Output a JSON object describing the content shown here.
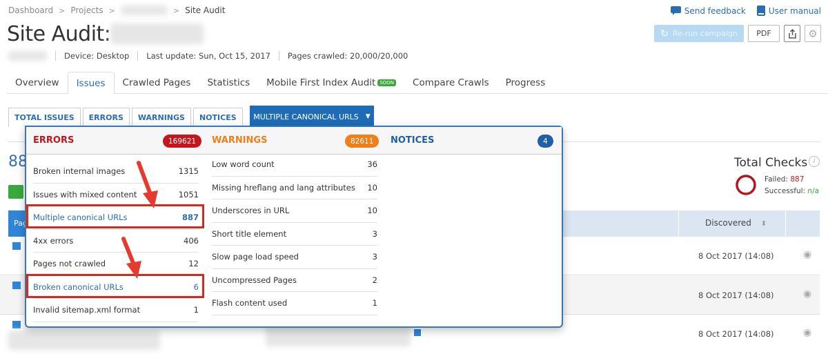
{
  "breadcrumb": [
    "Dashboard",
    "Projects",
    "Site Audit"
  ],
  "page_title": "Site Audit:",
  "meta": {
    "device": "Device: Desktop",
    "last_update": "Last update: Sun, Oct 15, 2017",
    "pages_crawled": "Pages crawled: 20,000/20,000"
  },
  "top_links": {
    "feedback": "Send feedback",
    "manual": "User manual"
  },
  "toolbar": {
    "rerun": "Re-run campaign",
    "pdf": "PDF"
  },
  "tabs": [
    {
      "label": "Overview"
    },
    {
      "label": "Issues",
      "active": true
    },
    {
      "label": "Crawled Pages"
    },
    {
      "label": "Statistics"
    },
    {
      "label": "Mobile First Index Audit",
      "badge": "SOON"
    },
    {
      "label": "Compare Crawls"
    },
    {
      "label": "Progress"
    }
  ],
  "subtabs": [
    "TOTAL ISSUES",
    "ERRORS",
    "WARNINGS",
    "NOTICES"
  ],
  "issue_dropdown": {
    "selected": "MULTIPLE CANONICAL URLS"
  },
  "dropdown": {
    "errors": {
      "title": "ERRORS",
      "count": "169621",
      "color": "#c4161c",
      "items": [
        {
          "label": "Broken internal images",
          "count": "1315"
        },
        {
          "label": "Issues with mixed content",
          "count": "1051"
        },
        {
          "label": "Multiple canonical URLs",
          "count": "887",
          "highlighted": true
        },
        {
          "label": "4xx errors",
          "count": "406"
        },
        {
          "label": "Pages not crawled",
          "count": "12"
        },
        {
          "label": "Broken canonical URLs",
          "count": "6",
          "highlighted": true
        },
        {
          "label": "Invalid sitemap.xml format",
          "count": "1"
        }
      ]
    },
    "warnings": {
      "title": "WARNINGS",
      "count": "82611",
      "color": "#f07f1a",
      "items": [
        {
          "label": "Low word count",
          "count": "36"
        },
        {
          "label": "Missing hreflang and lang attributes",
          "count": "10"
        },
        {
          "label": "Underscores in URL",
          "count": "10"
        },
        {
          "label": "Short title element",
          "count": "3"
        },
        {
          "label": "Slow page load speed",
          "count": "3"
        },
        {
          "label": "Uncompressed Pages",
          "count": "2"
        },
        {
          "label": "Flash content used",
          "count": "1"
        }
      ]
    },
    "notices": {
      "title": "NOTICES",
      "count": "4",
      "color": "#1e5fa8"
    }
  },
  "background": {
    "issue_count_partial": "88"
  },
  "total_checks": {
    "title": "Total Checks",
    "failed_label": "Failed:",
    "failed": "887",
    "success_label": "Successful:",
    "success": "n/a"
  },
  "table": {
    "header_first_partial": "Pag",
    "discovered_header": "Discovered",
    "rows": [
      {
        "discovered": "8 Oct 2017 (14:08)"
      },
      {
        "discovered": "8 Oct 2017 (14:08)"
      },
      {
        "discovered": "8 Oct 2017 (14:08)"
      }
    ]
  }
}
